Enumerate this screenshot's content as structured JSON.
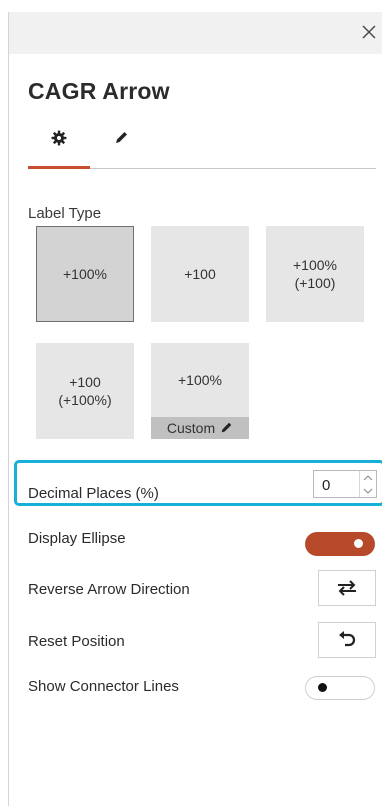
{
  "header": {
    "close_icon": "close-icon"
  },
  "title": "CAGR Arrow",
  "tabs": [
    {
      "name": "settings",
      "icon": "gear-icon",
      "active": true
    },
    {
      "name": "edit",
      "icon": "pencil-icon",
      "active": false
    }
  ],
  "accent_color": "#c84c2e",
  "highlight_color": "#16b0d8",
  "label_type": {
    "label": "Label Type",
    "options": [
      {
        "line1": "+100%",
        "line2": "",
        "selected": true
      },
      {
        "line1": "+100",
        "line2": "",
        "selected": false
      },
      {
        "line1": "+100%",
        "line2": "(+100)",
        "selected": false
      },
      {
        "line1": "+100",
        "line2": "(+100%)",
        "selected": false
      },
      {
        "line1": "+100%",
        "line2": "",
        "selected": false,
        "custom_label": "Custom"
      }
    ]
  },
  "decimal_places": {
    "label": "Decimal Places (%)",
    "value": "0"
  },
  "display_ellipse": {
    "label": "Display Ellipse",
    "on": true
  },
  "reverse_arrow": {
    "label": "Reverse Arrow Direction",
    "icon": "swap-arrows-icon"
  },
  "reset_position": {
    "label": "Reset Position",
    "icon": "undo-icon"
  },
  "connector_lines": {
    "label": "Show Connector Lines",
    "on": false
  }
}
